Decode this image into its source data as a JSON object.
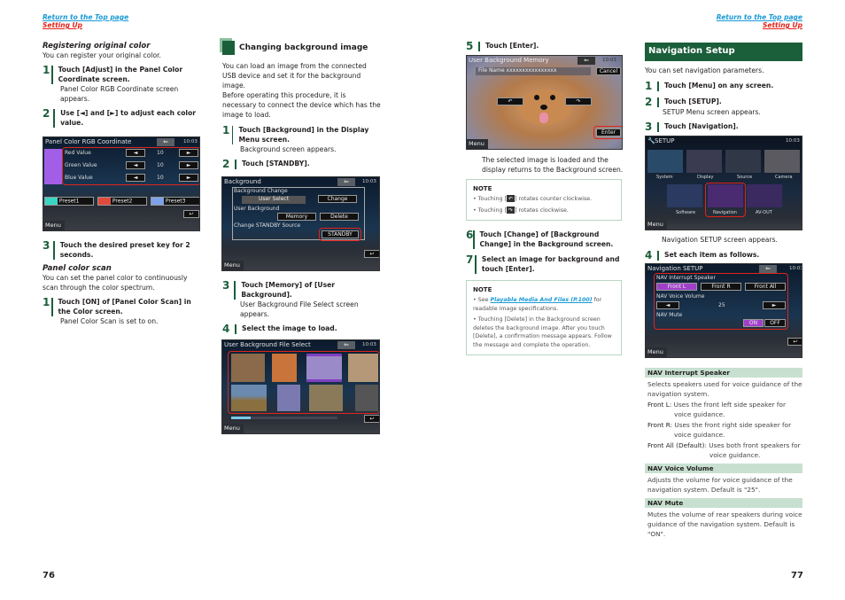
{
  "header": {
    "return_top": "Return to the Top page",
    "setting_up": "Setting Up"
  },
  "left": {
    "reg_title": "Registering original color",
    "reg_intro": "You can register your original color.",
    "step1_num": "1",
    "step1": "Touch [Adjust] in the Panel Color Coordinate screen.",
    "step1_sub": "Panel Color RGB Coordinate screen appears.",
    "step2_num": "2",
    "step2": "Use [◄] and [►] to adjust each color value.",
    "rgb_screen": {
      "title": "Panel Color RGB Coordinate",
      "time": "10:03",
      "rows": [
        {
          "label": "Red Value",
          "value": "10"
        },
        {
          "label": "Green Value",
          "value": "10"
        },
        {
          "label": "Blue Value",
          "value": "10"
        }
      ],
      "presets": [
        {
          "label": "Preset1",
          "color": "#3ad6c4"
        },
        {
          "label": "Preset2",
          "color": "#e04a3c"
        },
        {
          "label": "Preset3",
          "color": "#7ea2e8"
        }
      ],
      "swatch_color": "#a35ee8",
      "menu": "Menu"
    },
    "step3_num": "3",
    "step3": "Touch the desired preset key for 2 seconds.",
    "scan_title": "Panel color scan",
    "scan_intro": "You can set the panel color to continuously scan through the color spectrum.",
    "scan_step1_num": "1",
    "scan_step1": "Touch [ON] of [Panel Color Scan] in the Color screen.",
    "scan_step1_sub": "Panel Color Scan is set to on."
  },
  "mid": {
    "title": "Changing background image",
    "intro1": "You can load an image from the connected USB device and set it for the background image.",
    "intro2": "Before operating this procedure, it is necessary to connect the device which has the image to load.",
    "step1_num": "1",
    "step1": "Touch [Background] in the Display Menu screen.",
    "step1_sub": "Background screen appears.",
    "step2_num": "2",
    "step2": "Touch [STANDBY].",
    "bg_screen": {
      "title": "Background",
      "time": "10:03",
      "bg_change": "Background Change",
      "user_select": "User Select",
      "change": "Change",
      "user_bg": "User Background",
      "memory": "Memory",
      "delete": "Delete",
      "standby_src": "Change STANDBY Source",
      "standby": "STANDBY",
      "menu": "Menu"
    },
    "step3_num": "3",
    "step3": "Touch [Memory] of [User Background].",
    "step3_sub": "User Background File Select screen appears.",
    "step4_num": "4",
    "step4": "Select the image to load.",
    "file_screen": {
      "title": "User Background File Select",
      "time": "10:03",
      "menu": "Menu",
      "thumbs": [
        "#8a6a4a",
        "#c8743a",
        "#9b8ac8",
        "#b59878",
        "#6a8ab0",
        "#7a7ab0",
        "#8a7a5a",
        "#555"
      ]
    }
  },
  "col3": {
    "step5_num": "5",
    "step5": "Touch [Enter].",
    "mem_screen": {
      "title": "User Background Memory",
      "time": "10:03",
      "file_name": "File Name  xxxxxxxxxxxxxxxx",
      "cancel": "Cancel",
      "enter": "Enter",
      "menu": "Menu"
    },
    "step5_sub": "The selected image is loaded and the display returns to the Background screen.",
    "note1": {
      "title": "NOTE",
      "items": [
        "Touching [ ] rotates counter clockwise.",
        "Touching [ ] rotates clockwise."
      ]
    },
    "step6_num": "6",
    "step6": "Touch [Change] of [Background Change] in the Background screen.",
    "step7_num": "7",
    "step7": "Select an image for background and touch [Enter].",
    "note2": {
      "title": "NOTE",
      "see": "See ",
      "link": "Playable Media And Files (P.100)",
      "after_link": " for readable image specifications.",
      "item2": "Touching [Delete] in the Background screen deletes the background image. After you touch [Delete], a confirmation message appears. Follow the message and complete the operation."
    }
  },
  "right": {
    "title": "Navigation Setup",
    "intro": "You can set navigation parameters.",
    "step1_num": "1",
    "step1": "Touch [Menu] on any screen.",
    "step2_num": "2",
    "step2": "Touch [SETUP].",
    "step2_sub": "SETUP Menu screen appears.",
    "step3_num": "3",
    "step3": "Touch [Navigation].",
    "setup_screen": {
      "title": "SETUP",
      "time": "10:03",
      "items": [
        "System",
        "Display",
        "Source",
        "Camera",
        "Software",
        "Navigation",
        "AV-OUT"
      ],
      "menu": "Menu"
    },
    "step3_sub": "Navigation SETUP screen appears.",
    "step4_num": "4",
    "step4": "Set each item as follows.",
    "nav_screen": {
      "title": "Navigation SETUP",
      "time": "10:03",
      "speaker_label": "NAV Interrupt Speaker",
      "speakers": [
        "Front L",
        "Front R",
        "Front All"
      ],
      "volume_label": "NAV Voice Volume",
      "volume": "25",
      "mute_label": "NAV Mute",
      "on": "ON",
      "off": "OFF",
      "menu": "Menu",
      "accent": "#a040c8"
    },
    "sections": [
      {
        "heading": "NAV Interrupt Speaker",
        "desc": "Selects speakers used for voice guidance of the navigation system.",
        "defs": [
          {
            "term": "Front L",
            "def": ": Uses the front left side speaker for voice guidance."
          },
          {
            "term": "Front R",
            "def": ": Uses the front right side speaker for voice guidance."
          },
          {
            "term": "Front All (Default)",
            "def": ": Uses both front speakers for voice guidance."
          }
        ]
      },
      {
        "heading": "NAV Voice Volume",
        "desc": "Adjusts the volume for voice guidance of the navigation system. Default is \"25\"."
      },
      {
        "heading": "NAV Mute",
        "desc": "Mutes the volume of rear speakers during voice guidance of the navigation system. Default is \"ON\"."
      }
    ]
  },
  "footer": {
    "page_left": "76",
    "page_right": "77"
  },
  "colors": {
    "brand_green": "#1b5e3a",
    "link_blue": "#1a9ad6",
    "link_red": "#e2231a",
    "highlight_red": "#e2231a",
    "section_bg": "#c8e0d0"
  }
}
